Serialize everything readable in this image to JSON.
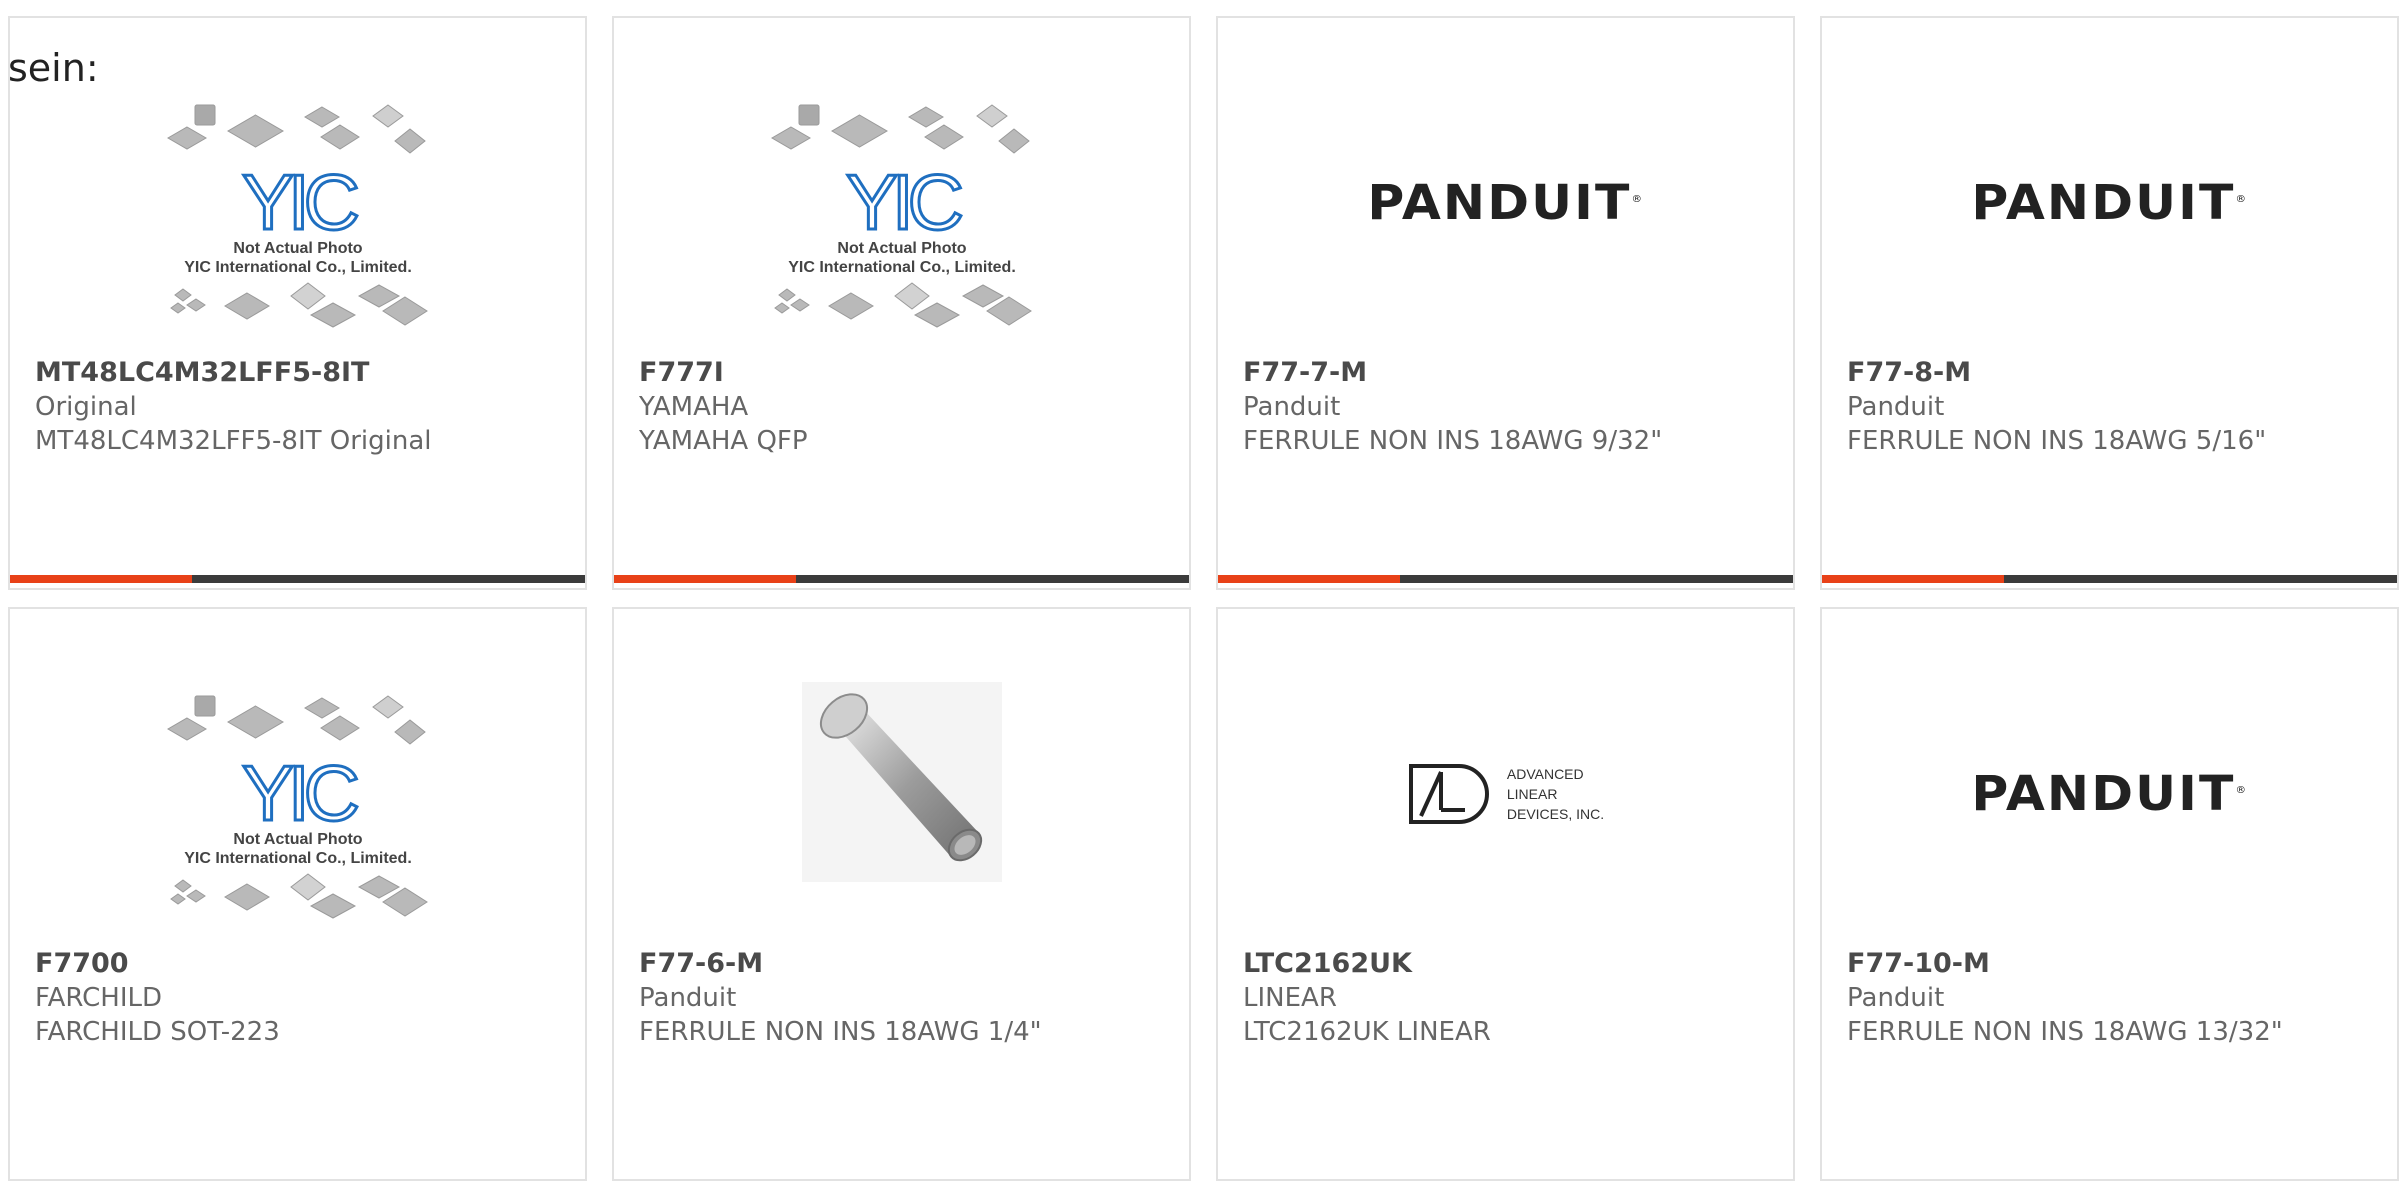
{
  "intro_text": "sein:",
  "yic_logo": {
    "line1": "Not Actual Photo",
    "line2": "YIC International Co., Limited."
  },
  "brand_colors": {
    "accent": "#e84118",
    "bar": "#3b3b3b",
    "yic_blue": "#1f6fc0"
  },
  "products": [
    {
      "pn": "MT48LC4M32LFF5-8IT",
      "mfr": "Original",
      "desc": "MT48LC4M32LFF5-8IT Original",
      "image": "yic-placeholder-image"
    },
    {
      "pn": "F777I",
      "mfr": "YAMAHA",
      "desc": "YAMAHA QFP",
      "image": "yic-placeholder-image"
    },
    {
      "pn": "F77-7-M",
      "mfr": "Panduit",
      "desc": "FERRULE NON INS 18AWG 9/32\"",
      "image": "panduit-logo",
      "logo_text": "PANDUIT"
    },
    {
      "pn": "F77-8-M",
      "mfr": "Panduit",
      "desc": "FERRULE NON INS 18AWG 5/16\"",
      "image": "panduit-logo",
      "logo_text": "PANDUIT"
    },
    {
      "pn": "F7700",
      "mfr": "FARCHILD",
      "desc": "FARCHILD SOT-223",
      "image": "yic-placeholder-image"
    },
    {
      "pn": "F77-6-M",
      "mfr": "Panduit",
      "desc": "FERRULE NON INS 18AWG 1/4\"",
      "image": "ferrule-photo"
    },
    {
      "pn": "LTC2162UK",
      "mfr": "LINEAR",
      "desc": "LTC2162UK LINEAR",
      "image": "ald-logo",
      "logo_lines": [
        "ADVANCED",
        "LINEAR",
        "DEVICES, INC."
      ]
    },
    {
      "pn": "F77-10-M",
      "mfr": "Panduit",
      "desc": "FERRULE NON INS 18AWG 13/32\"",
      "image": "panduit-logo",
      "logo_text": "PANDUIT"
    }
  ]
}
